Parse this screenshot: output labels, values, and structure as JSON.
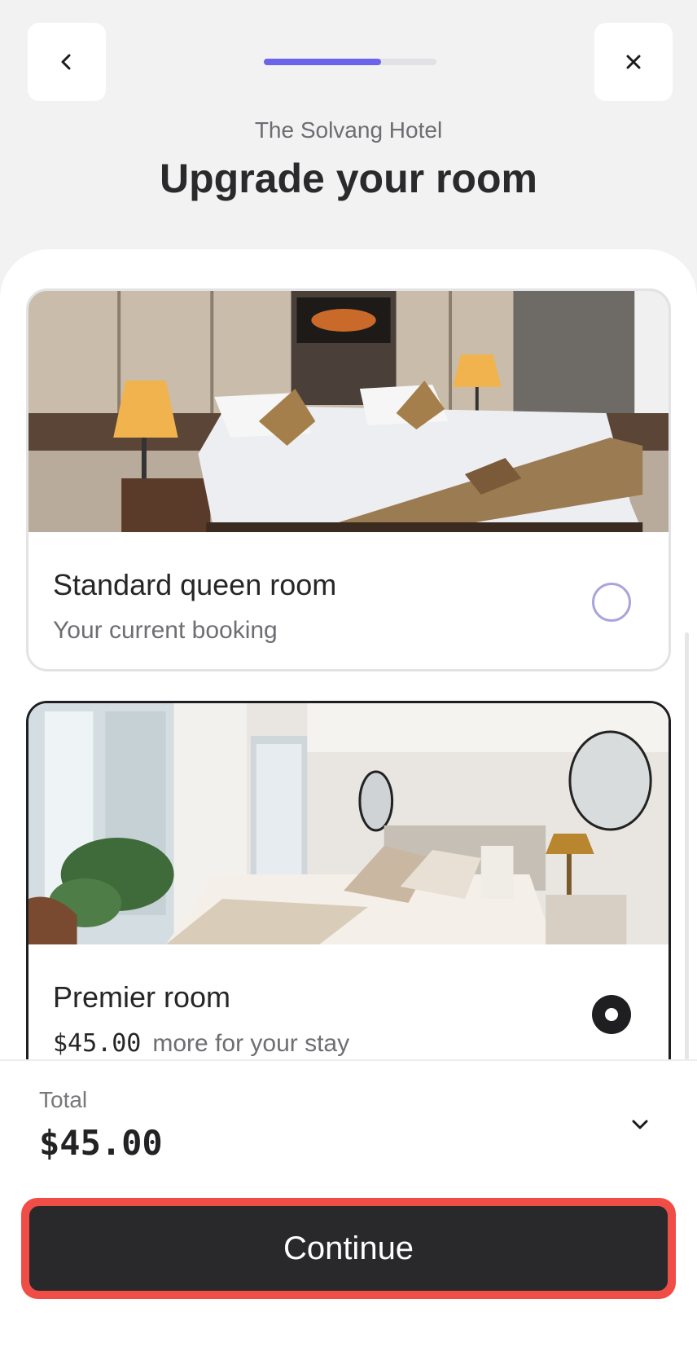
{
  "header": {
    "back_icon": "chevron-left-icon",
    "close_icon": "close-icon",
    "progress": 0.68,
    "hotel_name": "The Solvang Hotel",
    "title": "Upgrade your room"
  },
  "rooms": [
    {
      "name": "Standard queen room",
      "subtitle": "Your current booking",
      "selected": false,
      "photo": "hotel-room-photo-warm-lamps"
    },
    {
      "name": "Premier room",
      "price": "$45.00",
      "subtitle": "more for your stay",
      "selected": true,
      "photo": "hotel-room-photo-bright-window"
    }
  ],
  "footer": {
    "total_label": "Total",
    "total_value": "$45.00",
    "expand_icon": "chevron-down-icon",
    "continue_label": "Continue"
  },
  "colors": {
    "accent": "#6b64ea",
    "highlight": "#ef4d45",
    "primary_button": "#29292b"
  }
}
